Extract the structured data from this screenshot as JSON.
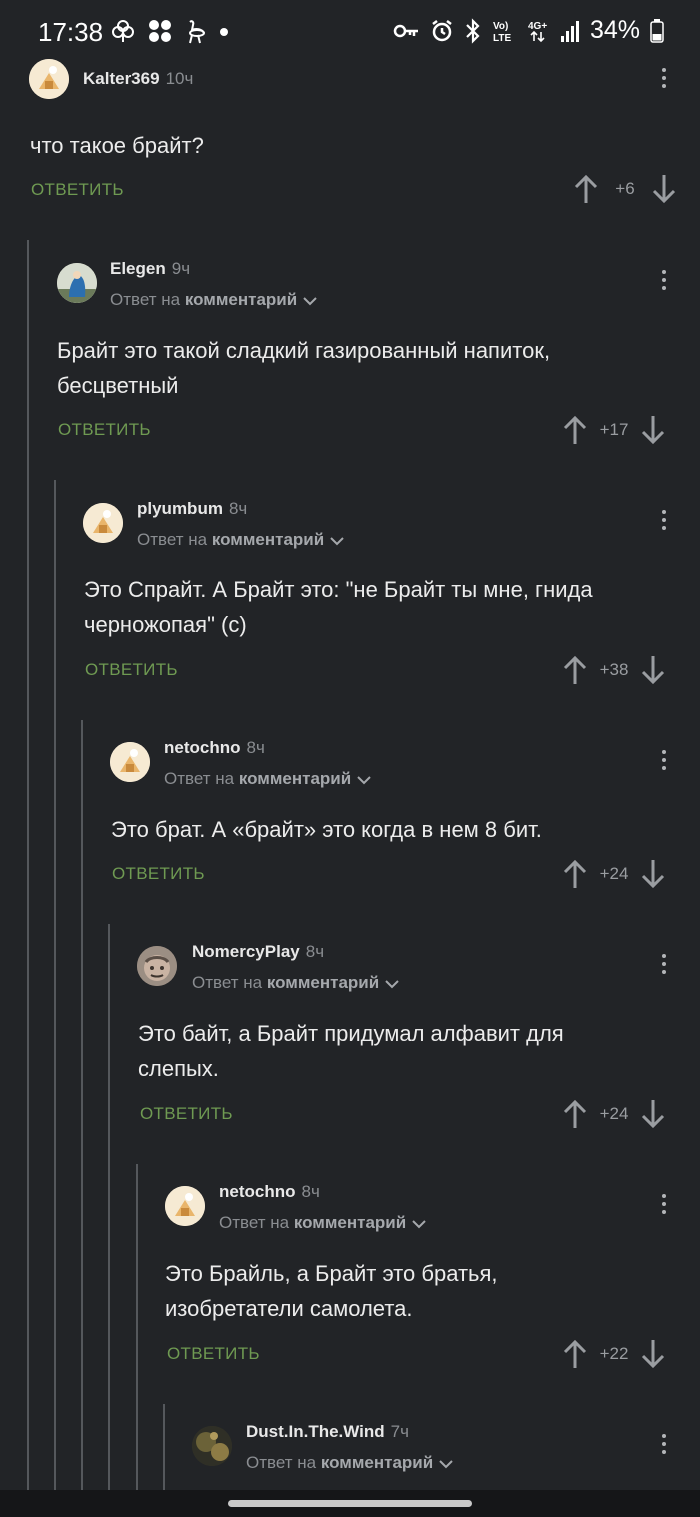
{
  "status_bar": {
    "time": "17:38",
    "battery": "34%",
    "icons_left": [
      "flower-icon",
      "cluster-icon",
      "ostrich-icon",
      "dot-icon"
    ],
    "icons_right": [
      "key-icon",
      "alarm-icon",
      "bluetooth-icon",
      "volte-icon",
      "4g-icon",
      "signal-icon",
      "battery-icon"
    ]
  },
  "labels": {
    "reply": "ОТВЕТИТЬ",
    "reply_to_prefix": "Ответ на",
    "reply_to_target": "комментарий"
  },
  "comments": [
    {
      "user": "Kalter369",
      "time": "10ч",
      "text": "что такое брайт?",
      "score": "+6"
    },
    {
      "user": "Elegen",
      "time": "9ч",
      "text": "Брайт это такой сладкий газированный напиток, бесцветный",
      "score": "+17"
    },
    {
      "user": "plyumbum",
      "time": "8ч",
      "text": "Это Спрайт. А Брайт это: \"не Брайт ты мне, гнида черножопая\" (с)",
      "score": "+38"
    },
    {
      "user": "netochno",
      "time": "8ч",
      "text": "Это брат. А «брайт» это когда в нем 8 бит.",
      "score": "+24"
    },
    {
      "user": "NomercyPlay",
      "time": "8ч",
      "text": "Это байт, а Брайт придумал алфавит для слепых.",
      "score": "+24"
    },
    {
      "user": "netochno",
      "time": "8ч",
      "text": "Это Брайль, а Брайт это братья, изобретатели самолета.",
      "score": "+22"
    },
    {
      "user": "Dust.In.The.Wind",
      "time": "7ч",
      "text": "",
      "score": ""
    }
  ]
}
